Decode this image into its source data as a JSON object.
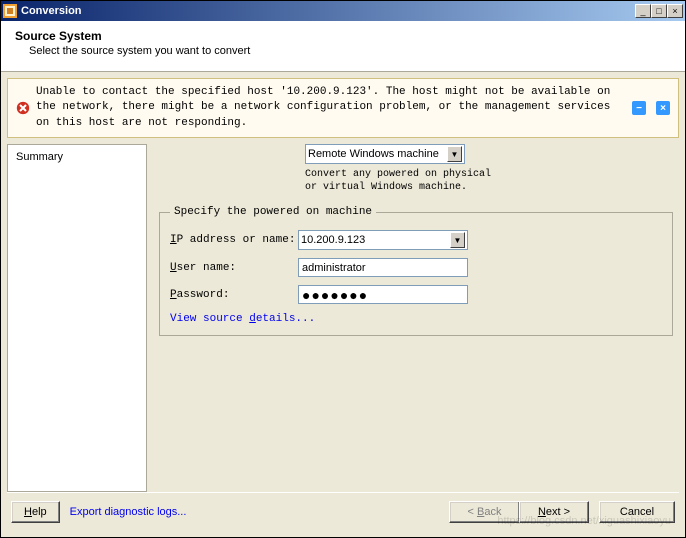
{
  "window": {
    "title": "Conversion"
  },
  "header": {
    "title": "Source System",
    "subtitle": "Select the source system you want to convert"
  },
  "error": {
    "message": "Unable to contact the specified host '10.200.9.123'. The host might not be available on the network, there might be a network configuration problem, or the management services on this host are not responding.",
    "minimize": "−",
    "close": "×"
  },
  "sidebar": {
    "items": [
      {
        "label": "Summary"
      }
    ]
  },
  "source_type": {
    "selected": "Remote Windows machine",
    "description": "Convert any powered on physical or virtual Windows machine."
  },
  "group": {
    "legend": "Specify the powered on machine",
    "fields": {
      "ip_label": "IP address or name:",
      "ip_value": "10.200.9.123",
      "user_label": "User name:",
      "user_value": "administrator",
      "pass_label": "Password:",
      "pass_value": "●●●●●●●"
    },
    "details_link_pre": "View source ",
    "details_link_u": "d",
    "details_link_post": "etails..."
  },
  "footer": {
    "help": "Help",
    "export_link": "Export diagnostic logs...",
    "back": "< Back",
    "next": "Next >",
    "cancel": "Cancel"
  },
  "watermark": "https://blog.csdn.net/xiguashixiaoyu"
}
